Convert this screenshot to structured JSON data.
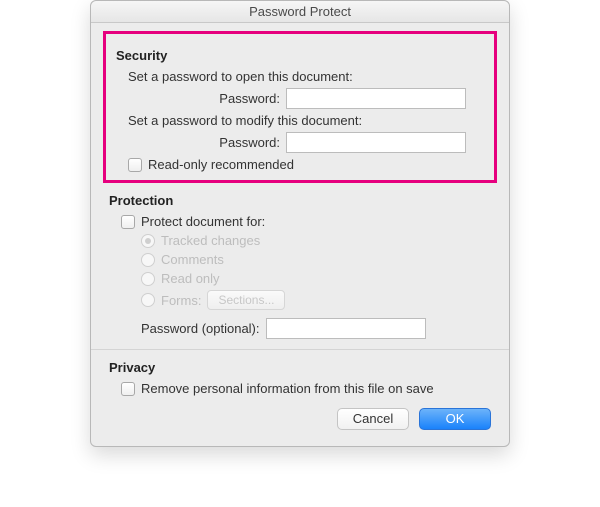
{
  "window": {
    "title": "Password Protect"
  },
  "security": {
    "heading": "Security",
    "open_instruction": "Set a password to open this document:",
    "open_label": "Password:",
    "modify_instruction": "Set a password to modify this document:",
    "modify_label": "Password:",
    "readonly_label": "Read-only recommended"
  },
  "protection": {
    "heading": "Protection",
    "protect_for_label": "Protect document for:",
    "radios": {
      "tracked": "Tracked changes",
      "comments": "Comments",
      "readonly": "Read only",
      "forms": "Forms:"
    },
    "sections_button": "Sections...",
    "password_label": "Password (optional):"
  },
  "privacy": {
    "heading": "Privacy",
    "remove_label": "Remove personal information from this file on save"
  },
  "buttons": {
    "cancel": "Cancel",
    "ok": "OK"
  }
}
